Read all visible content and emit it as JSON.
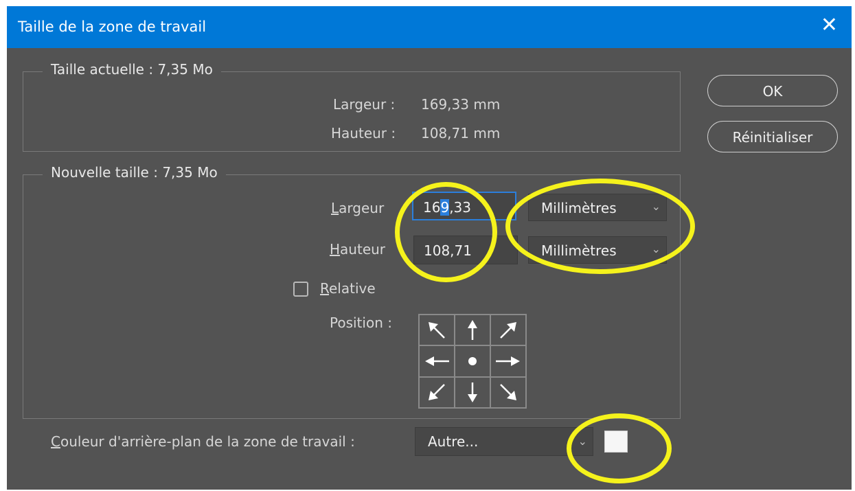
{
  "title": "Taille de la zone de travail",
  "current": {
    "legend": "Taille actuelle : 7,35 Mo",
    "width_label": "Largeur :",
    "width_value": "169,33 mm",
    "height_label": "Hauteur :",
    "height_value": "108,71 mm"
  },
  "new": {
    "legend": "Nouvelle taille : 7,35 Mo",
    "width_label_first": "L",
    "width_label_rest": "argeur",
    "width_value_pre": "16",
    "width_value_sel": "9",
    "width_value_post": ",33",
    "width_unit": "Millimètres",
    "height_label_first": "H",
    "height_label_rest": "auteur",
    "height_value": "108,71",
    "height_unit": "Millimètres",
    "relative_first": "R",
    "relative_rest": "elative",
    "relative_checked": false,
    "position_label": "Position :"
  },
  "buttons": {
    "ok": "OK",
    "reset": "Réinitialiser"
  },
  "background": {
    "label_first": "C",
    "label_rest": "ouleur d'arrière-plan de la zone de travail :",
    "value": "Autre...",
    "swatch_color": "#f6f6f6"
  },
  "colors": {
    "titlebar": "#0078d7",
    "dialog": "#535353",
    "highlight": "#f5f21c"
  }
}
